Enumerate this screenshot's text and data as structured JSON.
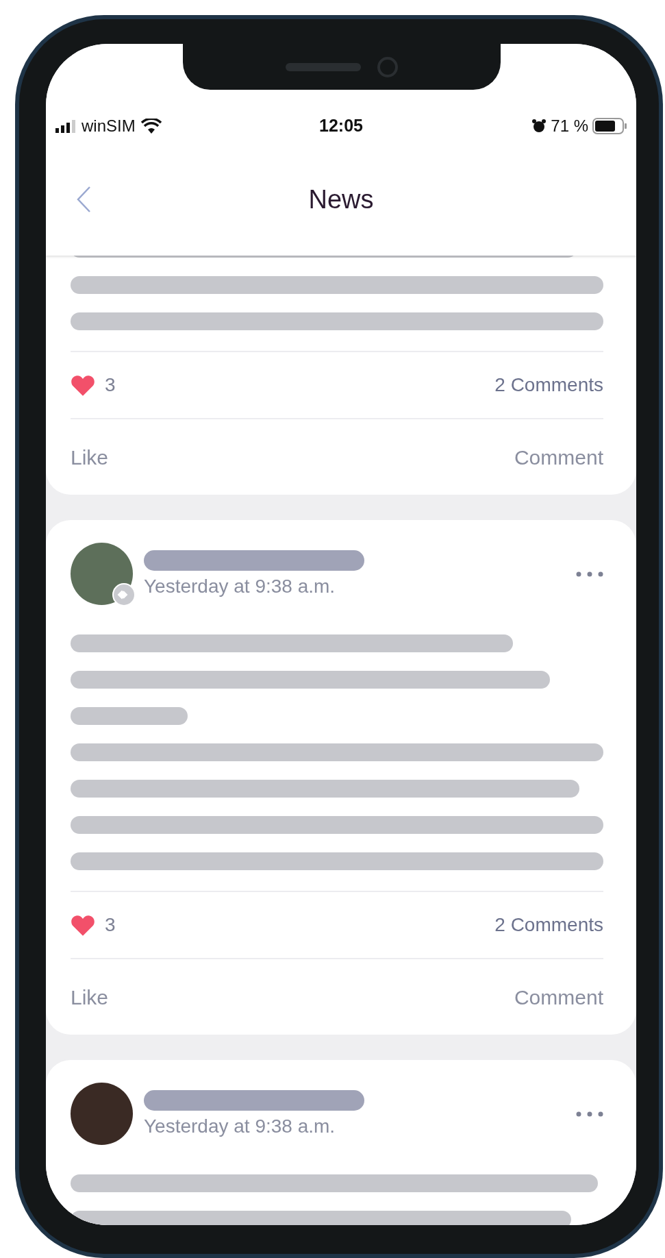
{
  "status_bar": {
    "carrier": "winSIM",
    "time": "12:05",
    "battery": "71 %"
  },
  "nav": {
    "title": "News"
  },
  "posts": [
    {
      "likes": "3",
      "comments": "2 Comments",
      "actions": [
        "Like",
        "Comment"
      ]
    },
    {
      "time": "Yesterday at 9:38 a.m.",
      "badge": true,
      "likes": "3",
      "comments": "2 Comments",
      "actions": [
        "Like",
        "Comment"
      ]
    },
    {
      "time": "Yesterday at 9:38 a.m.",
      "badge": false
    }
  ]
}
